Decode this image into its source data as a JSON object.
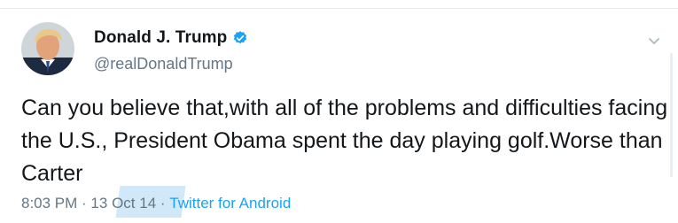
{
  "author": {
    "display_name": "Donald J. Trump",
    "handle": "@realDonaldTrump",
    "verified": true
  },
  "tweet": {
    "text": "Can you believe that,with all of the problems and difficulties facing the U.S., President Obama spent the day playing golf.Worse than Carter"
  },
  "meta": {
    "time": "8:03 PM",
    "separator_1": " · ",
    "day": "13",
    "date": " Oct 14",
    "separator_2": " · ",
    "source": "Twitter for Android"
  },
  "colors": {
    "text_primary": "#14171a",
    "text_secondary": "#657786",
    "link": "#1da1f2",
    "verified_badge": "#1da1f2"
  },
  "icons": {
    "verified": "verified-badge-icon",
    "menu": "chevron-down-icon"
  }
}
